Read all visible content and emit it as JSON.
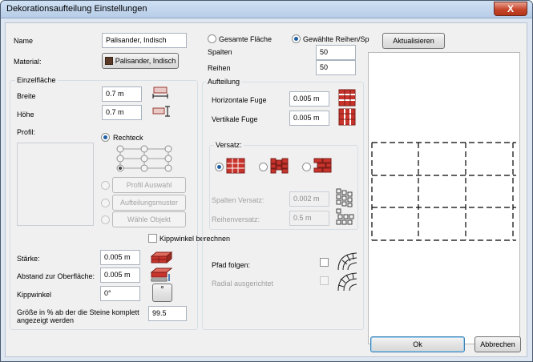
{
  "window": {
    "title": "Dekorationsaufteilung Einstellungen",
    "close_glyph": "X"
  },
  "name": {
    "label": "Name",
    "value": "Palisander, Indisch"
  },
  "material": {
    "label": "Material:",
    "button": "Palisander, Indisch",
    "swatch_color": "#5a3a26"
  },
  "einzelflaeche": {
    "title": "Einzelfläche",
    "breite_label": "Breite",
    "breite_value": "0.7 m",
    "hoehe_label": "Höhe",
    "hoehe_value": "0.7 m",
    "profil_label": "Profil:",
    "rechteck_label": "Rechteck",
    "profil_auswahl": "Profil Auswahl",
    "aufteilungsmuster": "Aufteilungsmuster",
    "waehle_objekt": "Wähle Objekt",
    "kippwinkel_check_label": "Kippwinkel berechnen",
    "staerke_label": "Stärke:",
    "staerke_value": "0.005 m",
    "abstand_label": "Abstand zur Oberfläche:",
    "abstand_value": "0.005 m",
    "kippwinkel_label": "Kippwinkel",
    "kippwinkel_value": "0°",
    "degree_button": "°",
    "groesse_label_1": "Größe in % ab der die Steine komplett",
    "groesse_label_2": "angezeigt werden",
    "groesse_value": "99.5"
  },
  "scope": {
    "gesamte_flaeche": "Gesamte Fläche",
    "gewaehlte": "Gewählte Reihen/Sp",
    "spalten_label": "Spalten",
    "spalten_value": "50",
    "reihen_label": "Reihen",
    "reihen_value": "50"
  },
  "aufteilung": {
    "title": "Aufteilung",
    "h_fuge_label": "Horizontale Fuge",
    "h_fuge_value": "0.005 m",
    "v_fuge_label": "Vertikale Fuge",
    "v_fuge_value": "0.005 m",
    "versatz_title": "Versatz:",
    "spalten_versatz_label": "Spalten Versatz:",
    "spalten_versatz_value": "0.002 m",
    "reihen_versatz_label": "Reihenversatz:",
    "reihen_versatz_value": "0.5 m",
    "pfad_label": "Pfad folgen:",
    "radial_label": "Radial ausgerichtet"
  },
  "actions": {
    "aktualisieren": "Aktualisieren",
    "ok": "Ok",
    "abbrechen": "Abbrechen"
  },
  "colors": {
    "brick": "#c8342c",
    "brick_dark": "#7a1d18",
    "accent": "#1d5ea5"
  }
}
